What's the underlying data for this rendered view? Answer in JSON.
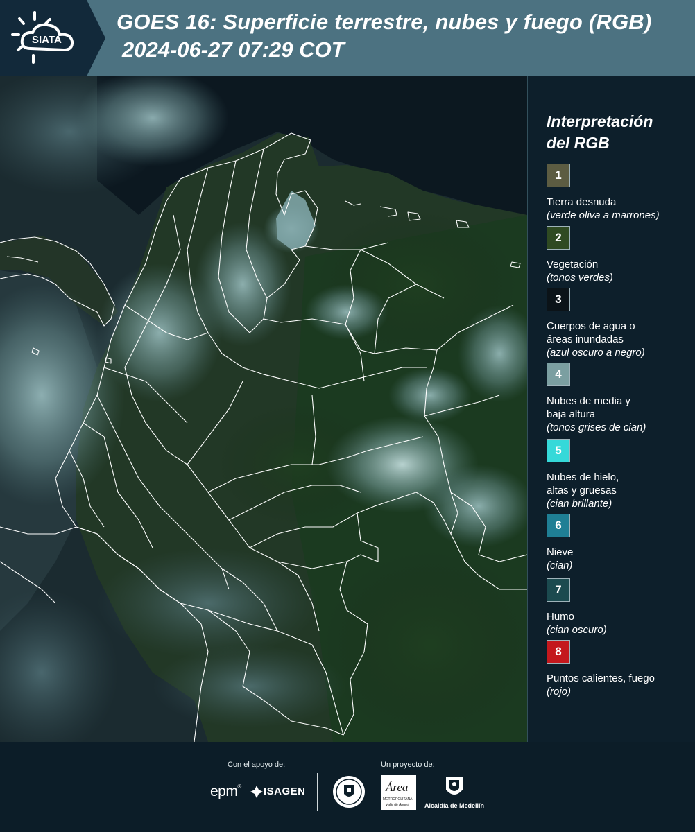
{
  "header": {
    "logo_text": "SIATA",
    "title": "GOES 16: Superficie terrestre, nubes y fuego (RGB)",
    "subtitle": "2024-06-27 07:29 COT"
  },
  "legend": {
    "title_line1": "Interpretación",
    "title_line2": "del RGB",
    "items": [
      {
        "number": "1",
        "color": "#5c5c42",
        "label_lines": [
          "Tierra desnuda"
        ],
        "desc": "(verde oliva a marrones)"
      },
      {
        "number": "2",
        "color": "#2f4a22",
        "label_lines": [
          "Vegetación"
        ],
        "desc": "(tonos verdes)"
      },
      {
        "number": "3",
        "color": "#0b1318",
        "label_lines": [
          "Cuerpos de agua o",
          "áreas inundadas"
        ],
        "desc": "(azul oscuro a negro)"
      },
      {
        "number": "4",
        "color": "#7b9fa1",
        "label_lines": [
          "Nubes de media y",
          "baja altura"
        ],
        "desc": "(tonos grises de cian)"
      },
      {
        "number": "5",
        "color": "#35d9d9",
        "label_lines": [
          "Nubes de hielo,",
          "altas y gruesas"
        ],
        "desc": "(cian brillante)"
      },
      {
        "number": "6",
        "color": "#1f7f95",
        "label_lines": [
          "Nieve"
        ],
        "desc": "(cian)"
      },
      {
        "number": "7",
        "color": "#1b4a4f",
        "label_lines": [
          "Humo"
        ],
        "desc": "(cian oscuro)"
      },
      {
        "number": "8",
        "color": "#c4181d",
        "label_lines": [
          "Puntos calientes, fuego"
        ],
        "desc": "(rojo)"
      }
    ]
  },
  "footer": {
    "support_label": "Con el apoyo de:",
    "project_label": "Un proyecto de:",
    "epm": "epm",
    "isagen": "ISAGEN",
    "area_word": "Área",
    "area_sub1": "METROPOLITANA",
    "area_sub2": "Valle de Aburrá",
    "alcaldia": "Alcaldía de Medellín"
  }
}
